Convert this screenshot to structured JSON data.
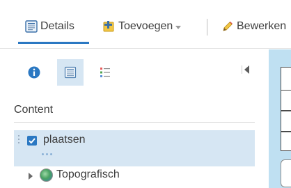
{
  "toolbar": {
    "details_label": "Details",
    "add_label": "Toevoegen",
    "edit_label": "Bewerken"
  },
  "panel": {
    "content_heading": "Content",
    "layers": [
      {
        "name": "plaatsen",
        "checked": true
      },
      {
        "name": "Topografisch"
      }
    ]
  },
  "colors": {
    "accent": "#2b78c2",
    "selected_bg": "#d6e6f3",
    "map_bg": "#bfe0f2"
  }
}
